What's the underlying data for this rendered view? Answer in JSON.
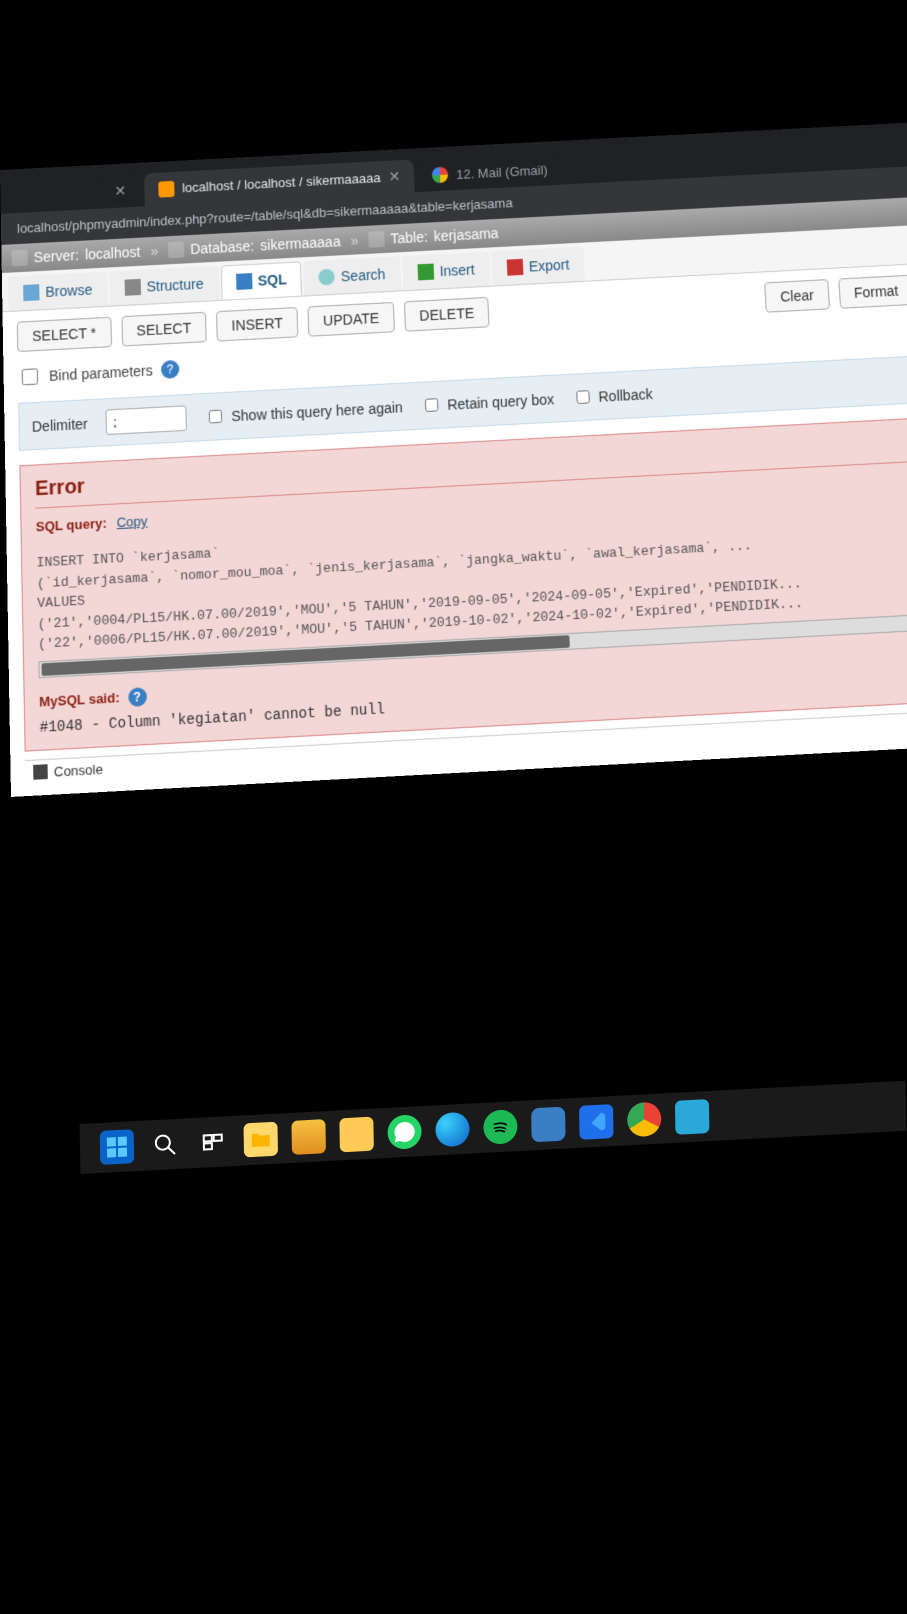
{
  "browser": {
    "tabs": [
      {
        "title": "localhost / localhost / sikermaaaaa"
      },
      {
        "title": "12. Mail (Gmail)"
      }
    ],
    "url": "localhost/phpmyadmin/index.php?route=/table/sql&db=sikermaaaaa&table=kerjasama"
  },
  "breadcrumb": {
    "server_label": "Server:",
    "server": "localhost",
    "db_label": "Database:",
    "db": "sikermaaaaa",
    "table_label": "Table:",
    "table": "kerjasama"
  },
  "topnav": {
    "browse": "Browse",
    "structure": "Structure",
    "sql": "SQL",
    "search": "Search",
    "insert": "Insert",
    "export": "Export"
  },
  "query_buttons": {
    "select_star": "SELECT *",
    "select": "SELECT",
    "insert": "INSERT",
    "update": "UPDATE",
    "delete": "DELETE",
    "clear": "Clear",
    "format": "Format"
  },
  "bind_parameters_label": "Bind parameters",
  "options": {
    "delimiter_label": "Delimiter",
    "delimiter_value": ";",
    "show_again": "Show this query here again",
    "retain_box": "Retain query box",
    "rollback": "Rollback"
  },
  "error": {
    "heading": "Error",
    "sql_query_label": "SQL query:",
    "copy": "Copy",
    "sql_text": "INSERT INTO `kerjasama`\n(`id_kerjasama`, `nomor_mou_moa`, `jenis_kerjasama`, `jangka_waktu`, `awal_kerjasama`, ...\nVALUES\n('21','0004/PL15/HK.07.00/2019','MOU','5 TAHUN','2019-09-05','2024-09-05','Expired','PENDIDIK...\n('22','0006/PL15/HK.07.00/2019','MOU','5 TAHUN','2019-10-02','2024-10-02','Expired','PENDIDIK...",
    "mysql_said_label": "MySQL said:",
    "code": "#1048",
    "message": "Column 'kegiatan' cannot be null"
  },
  "console_label": "Console",
  "taskbar": {
    "items": [
      "start",
      "search",
      "task-view",
      "explorer",
      "app1",
      "folder",
      "whatsapp",
      "edge",
      "spotify",
      "app2",
      "vscode",
      "chrome",
      "app3"
    ]
  }
}
